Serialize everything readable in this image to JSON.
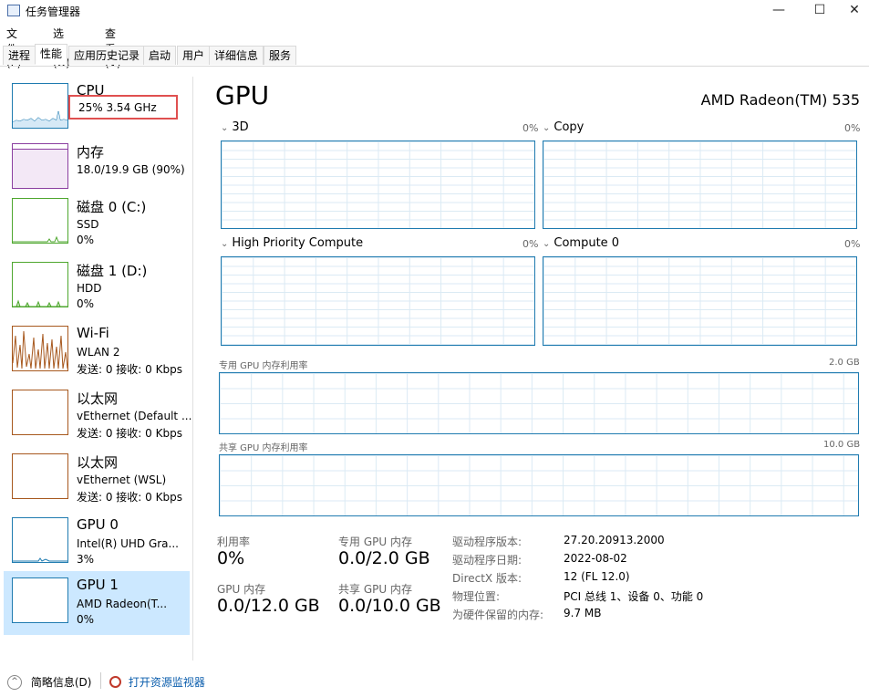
{
  "window": {
    "title": "任务管理器",
    "minimize_glyph": "—",
    "maximize_glyph": "☐",
    "close_glyph": "✕"
  },
  "menu": [
    "文件(F)",
    "选项(O)",
    "查看(V)"
  ],
  "tabs": [
    "进程",
    "性能",
    "应用历史记录",
    "启动",
    "用户",
    "详细信息",
    "服务"
  ],
  "active_tab": "性能",
  "sidebar": {
    "items": [
      {
        "title": "CPU",
        "line1": "25%  3.54 GHz",
        "line2": "",
        "color": "#1f7bb0"
      },
      {
        "title": "内存",
        "line1": "18.0/19.9 GB (90%)",
        "line2": "",
        "color": "#8b3fa0"
      },
      {
        "title": "磁盘 0 (C:)",
        "line1": "SSD",
        "line2": "0%",
        "color": "#4ea72e"
      },
      {
        "title": "磁盘 1 (D:)",
        "line1": "HDD",
        "line2": "0%",
        "color": "#4ea72e"
      },
      {
        "title": "Wi-Fi",
        "line1": "WLAN 2",
        "line2": "发送: 0 接收: 0 Kbps",
        "color": "#a7581e"
      },
      {
        "title": "以太网",
        "line1": "vEthernet (Default ...",
        "line2": "发送: 0 接收: 0 Kbps",
        "color": "#a7581e"
      },
      {
        "title": "以太网",
        "line1": "vEthernet (WSL)",
        "line2": "发送: 0 接收: 0 Kbps",
        "color": "#a7581e"
      },
      {
        "title": "GPU 0",
        "line1": "Intel(R) UHD Gra...",
        "line2": "3%",
        "color": "#1f7bb0"
      },
      {
        "title": "GPU 1",
        "line1": "AMD Radeon(T...",
        "line2": "0%",
        "color": "#1f7bb0"
      }
    ],
    "selected": "GPU 1"
  },
  "main": {
    "title": "GPU",
    "model": "AMD Radeon(TM) 535",
    "engines": [
      {
        "label": "3D",
        "pct": "0%"
      },
      {
        "label": "Copy",
        "pct": "0%"
      },
      {
        "label": "High Priority Compute",
        "pct": "0%"
      },
      {
        "label": "Compute 0",
        "pct": "0%"
      }
    ],
    "dedicated": {
      "label": "专用 GPU 内存利用率",
      "max": "2.0 GB"
    },
    "shared": {
      "label": "共享 GPU 内存利用率",
      "max": "10.0 GB"
    },
    "stats": {
      "util_label": "利用率",
      "util_value": "0%",
      "gpu_mem_label": "GPU 内存",
      "gpu_mem_value": "0.0/12.0 GB",
      "ded_mem_label": "专用 GPU 内存",
      "ded_mem_value": "0.0/2.0 GB",
      "shared_mem_label": "共享 GPU 内存",
      "shared_mem_value": "0.0/10.0 GB"
    },
    "info": [
      {
        "label": "驱动程序版本:",
        "value": "27.20.20913.2000"
      },
      {
        "label": "驱动程序日期:",
        "value": "2022-08-02"
      },
      {
        "label": "DirectX 版本:",
        "value": "12 (FL 12.0)"
      },
      {
        "label": "物理位置:",
        "value": "PCI 总线 1、设备 0、功能 0"
      },
      {
        "label": "为硬件保留的内存:",
        "value": "9.7 MB"
      }
    ]
  },
  "footer": {
    "summary": "简略信息(D)",
    "resource_monitor": "打开资源监视器",
    "summary_icon": "chevron-up-icon",
    "monitor_icon": "resource-monitor-icon"
  }
}
